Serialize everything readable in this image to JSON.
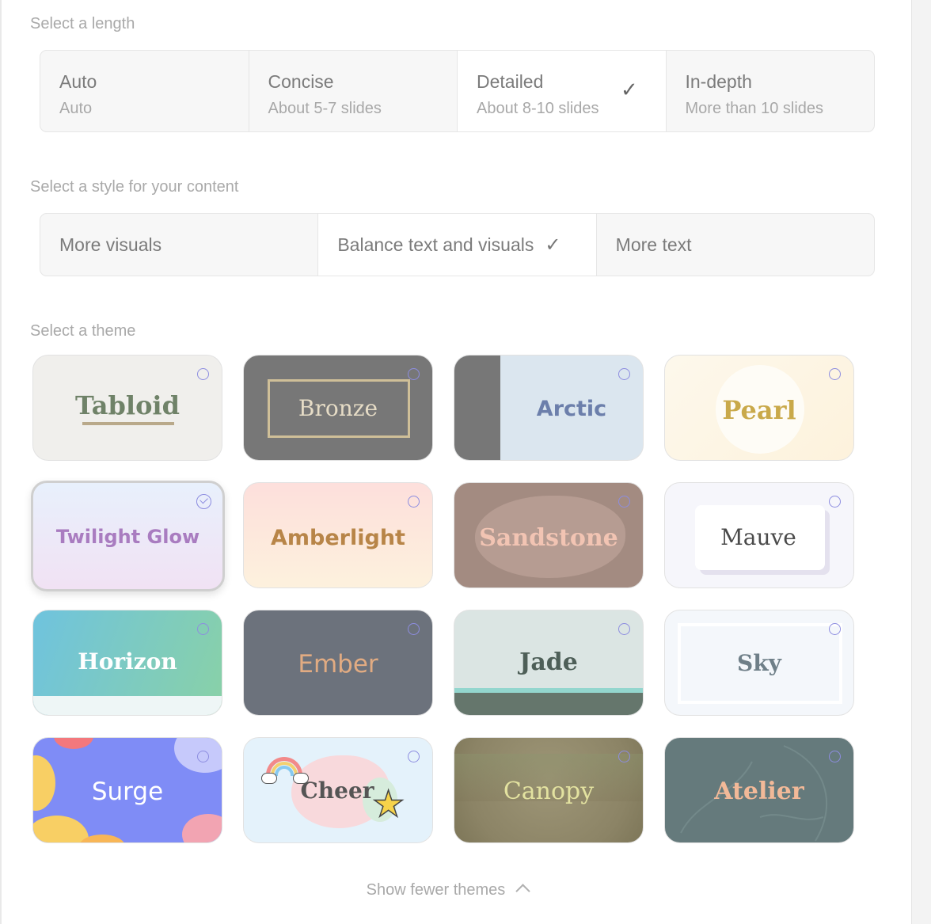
{
  "length": {
    "label": "Select a length",
    "options": [
      {
        "title": "Auto",
        "subtitle": "Auto"
      },
      {
        "title": "Concise",
        "subtitle": "About 5-7 slides"
      },
      {
        "title": "Detailed",
        "subtitle": "About 8-10 slides"
      },
      {
        "title": "In-depth",
        "subtitle": "More than 10 slides"
      }
    ],
    "selected": "Detailed"
  },
  "style": {
    "label": "Select a style for your content",
    "options": [
      "More visuals",
      "Balance text and visuals",
      "More text"
    ],
    "selected": "Balance text and visuals"
  },
  "theme": {
    "label": "Select a theme",
    "selected": "Twilight Glow",
    "cards": [
      {
        "name": "Tabloid",
        "text_color": "#6f8268",
        "bg": "#f0efec"
      },
      {
        "name": "Bronze",
        "text_color": "#e6dcc6",
        "bg": "#777777"
      },
      {
        "name": "Arctic",
        "text_color": "#6c7fab",
        "bg": "#dbe6ef"
      },
      {
        "name": "Pearl",
        "text_color": "#c9a94a",
        "bg": "#fdf7e9"
      },
      {
        "name": "Twilight Glow",
        "text_color": "#a97cc0",
        "bg": "#eef2fb"
      },
      {
        "name": "Amberlight",
        "text_color": "#b88548",
        "bg": "#fde4df"
      },
      {
        "name": "Sandstone",
        "text_color": "#f2c4b3",
        "bg": "#a38b81"
      },
      {
        "name": "Mauve",
        "text_color": "#4a4a4a",
        "bg": "#f6f6fb"
      },
      {
        "name": "Horizon",
        "text_color": "#ffffff",
        "bg": "#7cccc8"
      },
      {
        "name": "Ember",
        "text_color": "#e1ab82",
        "bg": "#6c727c"
      },
      {
        "name": "Jade",
        "text_color": "#4e5f58",
        "bg": "#dbe5e3"
      },
      {
        "name": "Sky",
        "text_color": "#6f7f88",
        "bg": "#f4f7fb"
      },
      {
        "name": "Surge",
        "text_color": "#ffffff",
        "bg": "#7f8cf6"
      },
      {
        "name": "Cheer",
        "text_color": "#555555",
        "bg": "#e4f2fb"
      },
      {
        "name": "Canopy",
        "text_color": "#e3e2a0",
        "bg": "#968e6f"
      },
      {
        "name": "Atelier",
        "text_color": "#f2b998",
        "bg": "#657a7c"
      }
    ]
  },
  "footer": {
    "show_fewer_label": "Show fewer themes"
  }
}
